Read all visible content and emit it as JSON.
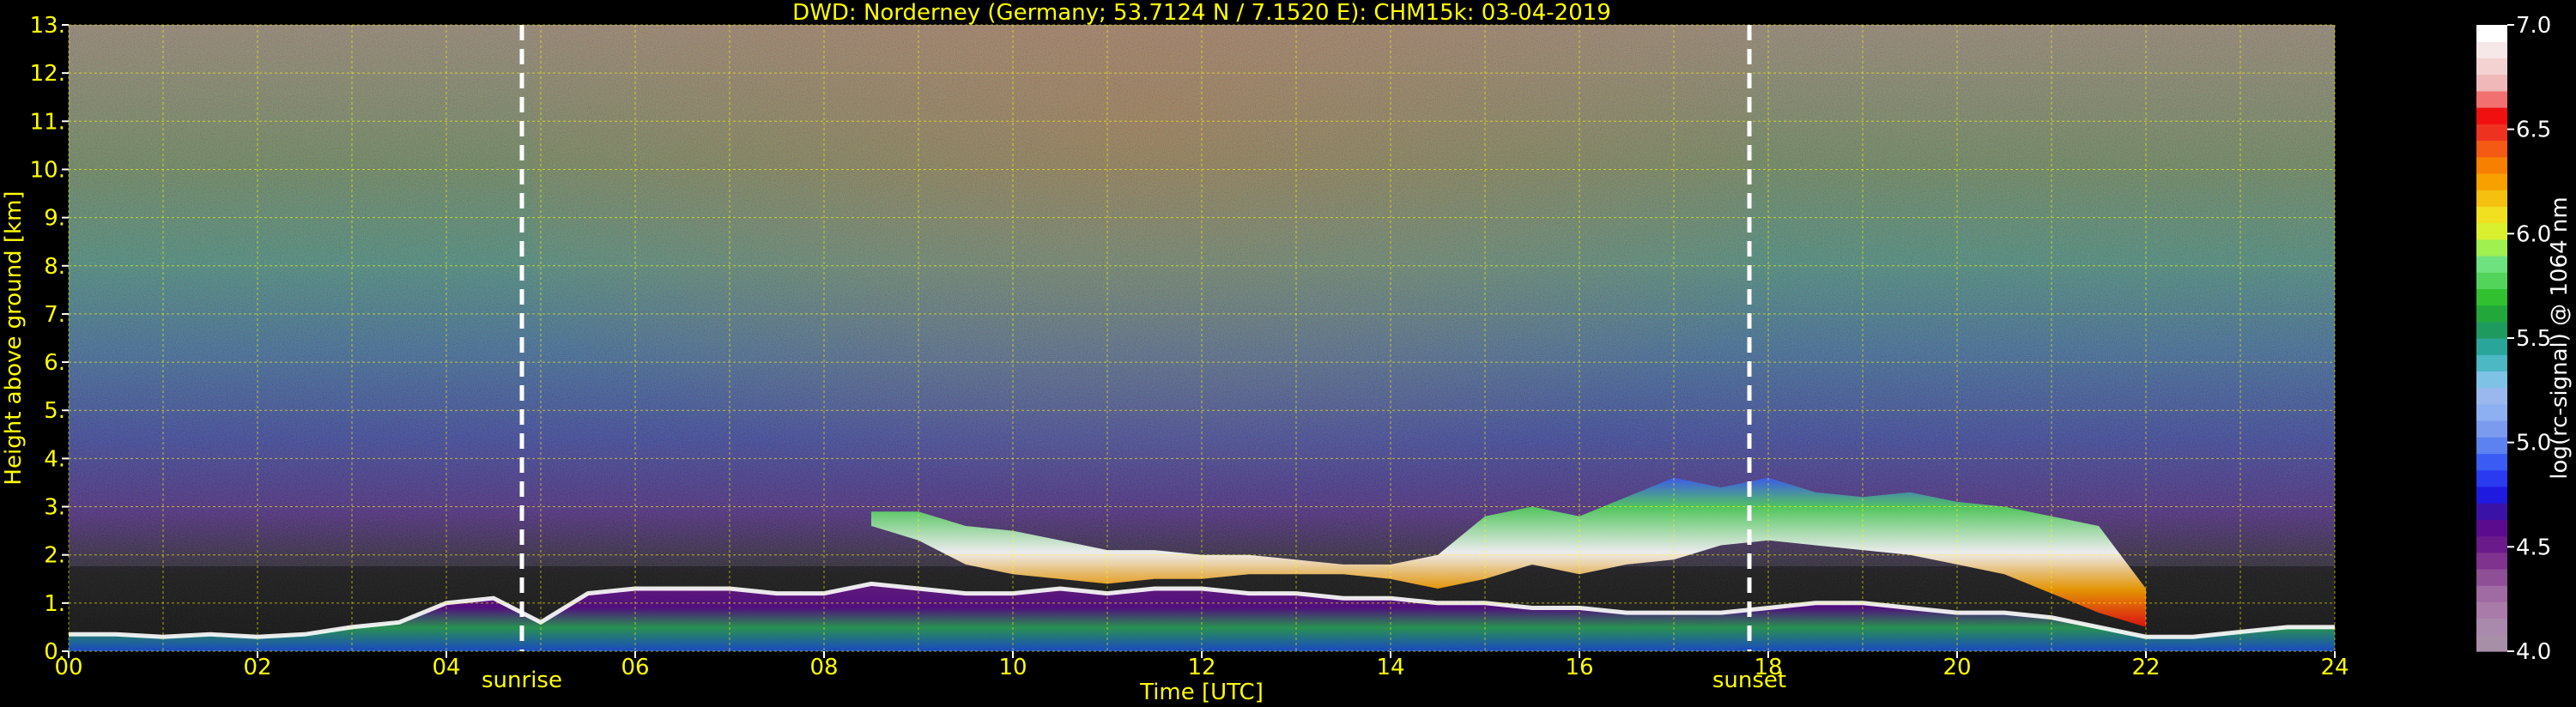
{
  "chart_data": {
    "type": "heatmap",
    "title": "DWD: Norderney (Germany; 53.7124 N / 7.1520 E):    CHM15k: 03-04-2019",
    "xlabel": "Time [UTC]",
    "ylabel": "Height above ground [km]",
    "xlim": [
      0,
      24
    ],
    "ylim": [
      0,
      13
    ],
    "xticks": [
      "00",
      "02",
      "04",
      "06",
      "08",
      "10",
      "12",
      "14",
      "16",
      "18",
      "20",
      "22",
      "24"
    ],
    "yticks": [
      "0.",
      "1.",
      "2.",
      "3.",
      "4.",
      "5.",
      "6.",
      "7.",
      "8.",
      "9.",
      "10.",
      "11.",
      "12.",
      "13."
    ],
    "grid": true,
    "colorbar": {
      "label": "log(rc-signal) @ 1064 nm",
      "range": [
        4.0,
        7.0
      ],
      "ticks": [
        "4.0",
        "4.5",
        "5.0",
        "5.5",
        "6.0",
        "6.5",
        "7.0"
      ],
      "colors": [
        "#a78fa8",
        "#a98aad",
        "#a97ba9",
        "#a06aa2",
        "#8f4f97",
        "#80338e",
        "#6a1a8a",
        "#5a0b8e",
        "#3a12a8",
        "#1e1ae0",
        "#2a3af0",
        "#3a5cf4",
        "#5b82f0",
        "#7a9bee",
        "#8cb0f2",
        "#9ab8ee",
        "#7ec2e6",
        "#4cb8c4",
        "#2aa59a",
        "#1f9a5e",
        "#22a83a",
        "#30c030",
        "#52d45a",
        "#6ee27e",
        "#a0f050",
        "#d8f030",
        "#f0e020",
        "#f5c010",
        "#f7a000",
        "#f88000",
        "#f55a14",
        "#ee3220",
        "#f01010",
        "#f27070",
        "#f0b8b8",
        "#f4d2d2",
        "#f6e8e8",
        "#ffffff"
      ]
    },
    "annotations": [
      {
        "text": "sunrise",
        "x": 4.8
      },
      {
        "text": "sunset",
        "x": 17.8
      }
    ],
    "layers": [
      {
        "name": "boundary layer",
        "x": [
          0,
          0.5,
          1,
          1.5,
          2,
          2.5,
          3,
          3.5,
          4,
          4.5,
          5,
          5.5,
          6,
          6.5,
          7,
          7.5,
          8,
          8.5,
          9,
          9.5,
          10,
          10.5,
          11,
          11.5,
          12,
          12.5,
          13,
          13.5,
          14,
          14.5,
          15,
          15.5,
          16,
          16.5,
          17,
          17.5,
          18,
          18.5,
          19,
          19.5,
          20,
          20.5,
          21,
          21.5,
          22,
          22.5,
          23,
          23.5,
          24
        ],
        "top": [
          0.35,
          0.35,
          0.3,
          0.35,
          0.3,
          0.35,
          0.5,
          0.6,
          1.0,
          1.1,
          0.6,
          1.2,
          1.3,
          1.3,
          1.3,
          1.2,
          1.2,
          1.4,
          1.3,
          1.2,
          1.2,
          1.3,
          1.2,
          1.3,
          1.3,
          1.2,
          1.2,
          1.1,
          1.1,
          1.0,
          1.0,
          0.9,
          0.9,
          0.8,
          0.8,
          0.8,
          0.9,
          1.0,
          1.0,
          0.9,
          0.8,
          0.8,
          0.7,
          0.5,
          0.3,
          0.3,
          0.4,
          0.5,
          0.5
        ]
      },
      {
        "name": "cloud layer",
        "x": [
          8.5,
          9,
          9.5,
          10,
          10.5,
          11,
          11.5,
          12,
          12.5,
          13,
          13.5,
          14,
          14.5,
          15,
          15.5,
          16,
          16.5,
          17,
          17.5,
          18,
          18.5,
          19,
          19.5,
          20,
          20.5,
          21,
          21.5,
          22
        ],
        "base": [
          2.6,
          2.3,
          1.8,
          1.6,
          1.5,
          1.4,
          1.5,
          1.5,
          1.6,
          1.6,
          1.6,
          1.5,
          1.3,
          1.5,
          1.8,
          1.6,
          1.8,
          1.9,
          2.2,
          2.3,
          2.2,
          2.1,
          2.0,
          1.8,
          1.6,
          1.2,
          0.8,
          0.5
        ],
        "top": [
          2.9,
          2.9,
          2.6,
          2.5,
          2.3,
          2.1,
          2.1,
          2.0,
          2.0,
          1.9,
          1.8,
          1.8,
          2.0,
          2.8,
          3.0,
          2.8,
          3.2,
          3.6,
          3.4,
          3.6,
          3.3,
          3.2,
          3.3,
          3.1,
          3.0,
          2.8,
          2.6,
          1.3
        ]
      }
    ]
  }
}
